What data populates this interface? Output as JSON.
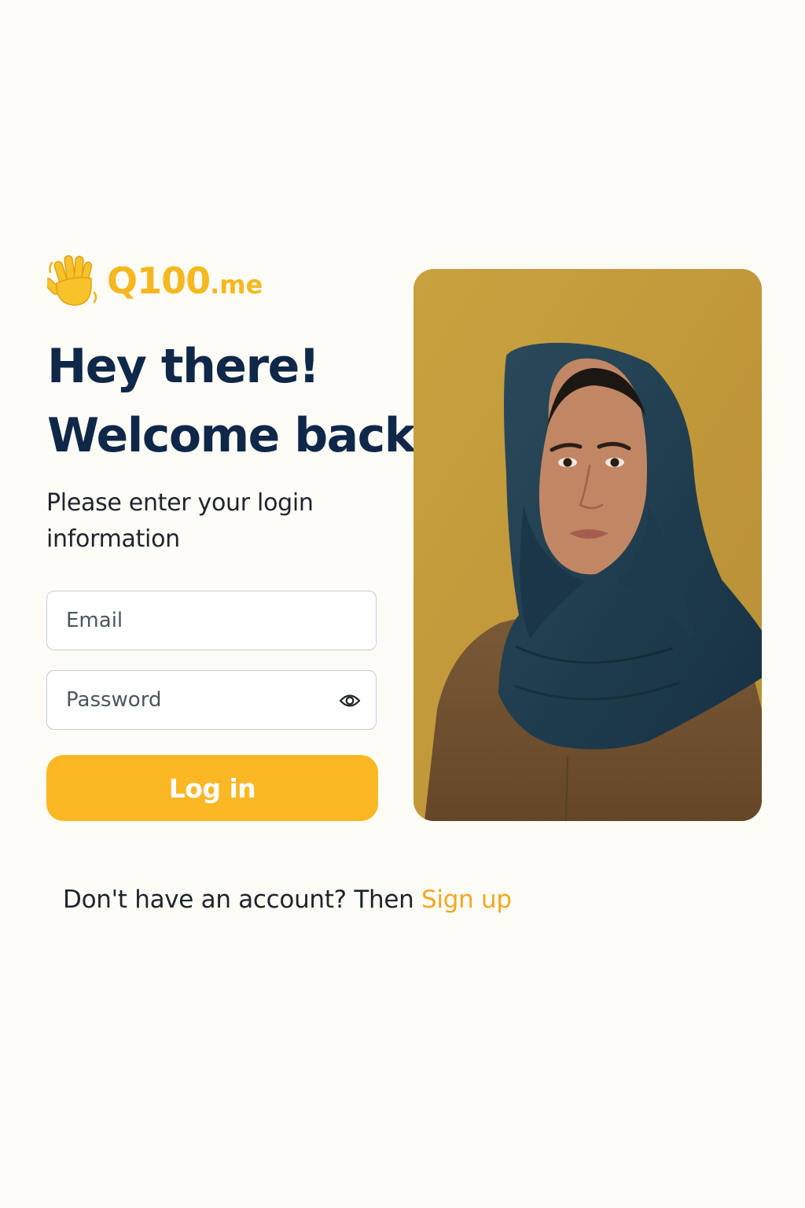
{
  "brand": {
    "name": "Q100",
    "suffix": ".me",
    "icon": "waving-hand-icon",
    "color": "#f6b820"
  },
  "heading": {
    "line1": "Hey there!",
    "line2": "Welcome back!"
  },
  "subtitle": "Please enter your login information",
  "form": {
    "email_placeholder": "Email",
    "password_placeholder": "Password",
    "password_toggle_icon": "eye-icon",
    "login_label": "Log in"
  },
  "footer": {
    "prompt": "Don't have an account? Then ",
    "signup_label": "Sign up"
  },
  "colors": {
    "background": "#fdfcf7",
    "heading": "#0f2749",
    "accent": "#fbb724",
    "link": "#f5a623",
    "photo_background": "#c19a3c"
  }
}
